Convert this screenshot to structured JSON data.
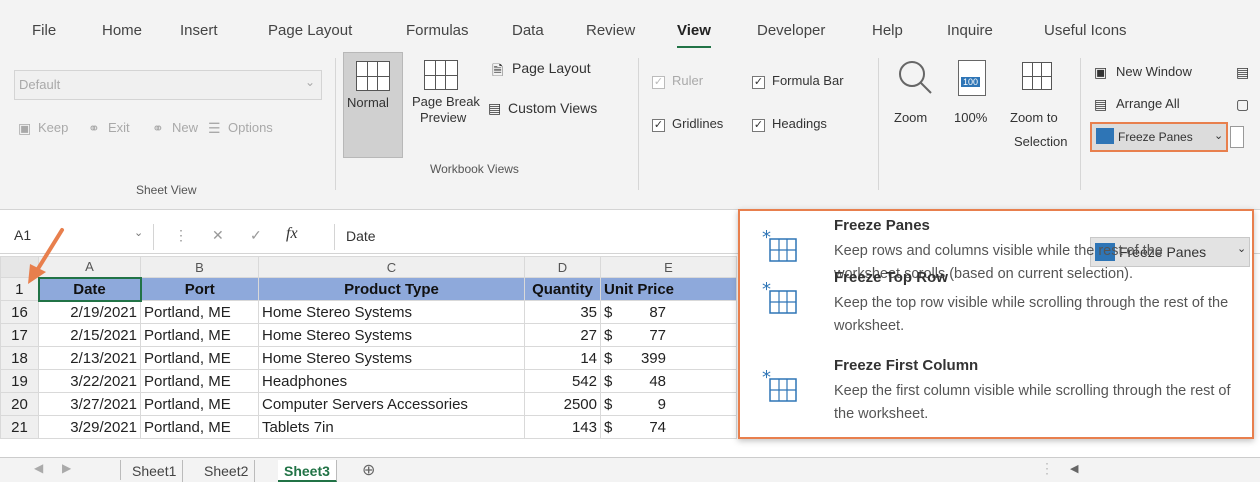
{
  "menu": [
    "File",
    "Home",
    "Insert",
    "Page Layout",
    "Formulas",
    "Data",
    "Review",
    "View",
    "Developer",
    "Help",
    "Inquire",
    "Useful Icons"
  ],
  "sheet_view": {
    "select_value": "Default",
    "keep": "Keep",
    "exit": "Exit",
    "new": "New",
    "options": "Options",
    "label": "Sheet View"
  },
  "workbook_views": {
    "normal": "Normal",
    "page_break_line1": "Page Break",
    "page_break_line2": "Preview",
    "page_layout": "Page Layout",
    "custom_views": "Custom Views",
    "label": "Workbook Views"
  },
  "show": {
    "ruler": "Ruler",
    "formula_bar": "Formula Bar",
    "gridlines": "Gridlines",
    "headings": "Headings",
    "ruler_checked": true,
    "formula_bar_checked": true,
    "gridlines_checked": true,
    "headings_checked": true
  },
  "zoom": {
    "zoom": "Zoom",
    "hundred": "100%",
    "hundred_icon": "100",
    "to_sel_line1": "Zoom to",
    "to_sel_line2": "Selection"
  },
  "window": {
    "new_window": "New Window",
    "arrange_all": "Arrange All",
    "freeze_panes": "Freeze Panes"
  },
  "formula_bar": {
    "name_box": "A1",
    "fx": "fx",
    "content": "Date"
  },
  "columns": [
    "A",
    "B",
    "C",
    "D",
    "E"
  ],
  "header_row": {
    "row_num": "1",
    "cells": [
      "Date",
      "Port",
      "Product Type",
      "Quantity",
      "Unit Price"
    ]
  },
  "rows": [
    {
      "num": "16",
      "date": "2/19/2021",
      "port": "Portland, ME",
      "product": "Home Stereo Systems",
      "qty": "35",
      "cur": "$",
      "price": "87"
    },
    {
      "num": "17",
      "date": "2/15/2021",
      "port": "Portland, ME",
      "product": "Home Stereo Systems",
      "qty": "27",
      "cur": "$",
      "price": "77"
    },
    {
      "num": "18",
      "date": "2/13/2021",
      "port": "Portland, ME",
      "product": "Home Stereo Systems",
      "qty": "14",
      "cur": "$",
      "price": "399"
    },
    {
      "num": "19",
      "date": "3/22/2021",
      "port": "Portland, ME",
      "product": "Headphones",
      "qty": "542",
      "cur": "$",
      "price": "48"
    },
    {
      "num": "20",
      "date": "3/27/2021",
      "port": "Portland, ME",
      "product": "Computer Servers Accessories",
      "qty": "2500",
      "cur": "$",
      "price": "9"
    },
    {
      "num": "21",
      "date": "3/29/2021",
      "port": "Portland, ME",
      "product": "Tablets 7in",
      "qty": "143",
      "cur": "$",
      "price": "74"
    }
  ],
  "freeze_menu": {
    "tooltip_label": "Freeze Panes",
    "items": [
      {
        "title": "Freeze Panes",
        "desc": "Keep rows and columns visible while the rest of the worksheet scrolls (based on current selection)."
      },
      {
        "title": "Freeze Top Row",
        "desc": "Keep the top row visible while scrolling through the rest of the worksheet."
      },
      {
        "title": "Freeze First Column",
        "desc": "Keep the first column visible while scrolling through the rest of the worksheet."
      }
    ]
  },
  "sheets": [
    "Sheet1",
    "Sheet2",
    "Sheet3"
  ],
  "active_sheet": "Sheet3",
  "colors": {
    "accent_green": "#217346",
    "header_fill": "#8ea9db",
    "highlight_orange": "#e87f4d",
    "icon_blue": "#2e75b6"
  }
}
